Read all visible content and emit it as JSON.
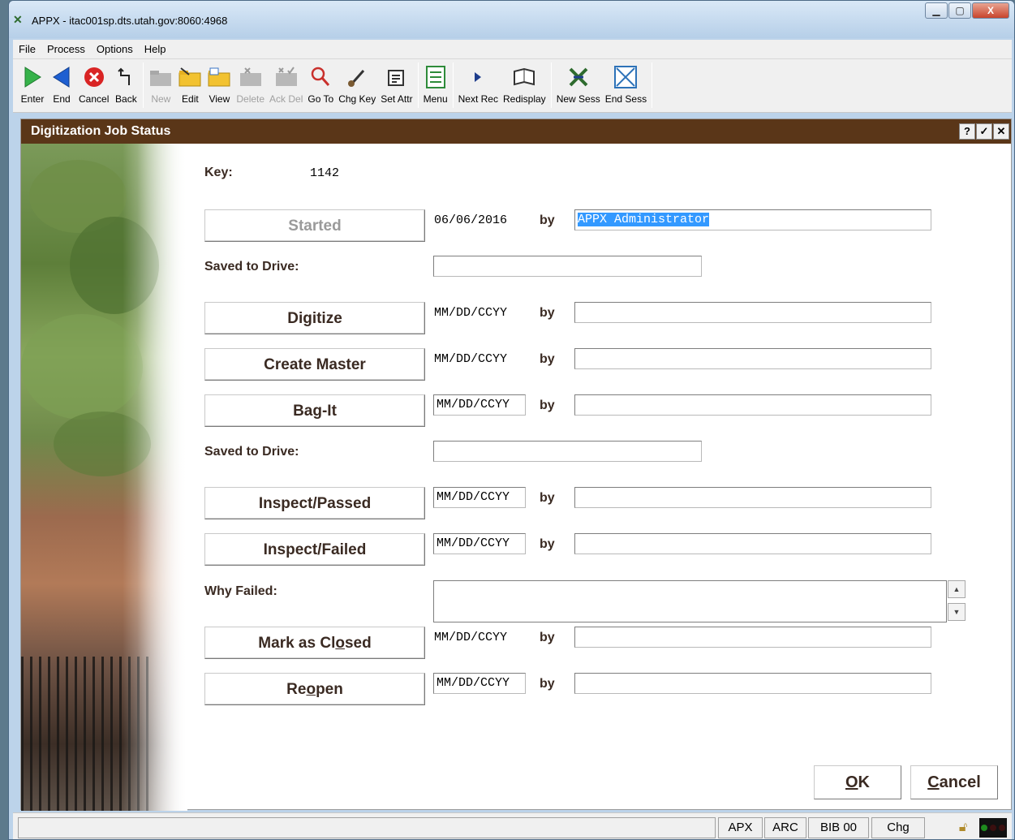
{
  "window": {
    "title": "APPX - itac001sp.dts.utah.gov:8060:4968",
    "controls": {
      "minimize": "▁",
      "maximize": "▢",
      "close": "X"
    }
  },
  "menu": [
    "File",
    "Process",
    "Options",
    "Help"
  ],
  "toolbar": [
    {
      "label": "Enter",
      "icon": "play-icon",
      "enabled": true
    },
    {
      "label": "End",
      "icon": "arrow-left-icon",
      "enabled": true
    },
    {
      "label": "Cancel",
      "icon": "cancel-icon",
      "enabled": true
    },
    {
      "label": "Back",
      "icon": "back-icon",
      "enabled": true
    },
    {
      "label": "New",
      "icon": "folder-new-icon",
      "enabled": false
    },
    {
      "label": "Edit",
      "icon": "folder-edit-icon",
      "enabled": true
    },
    {
      "label": "View",
      "icon": "folder-view-icon",
      "enabled": true
    },
    {
      "label": "Delete",
      "icon": "folder-delete-icon",
      "enabled": false
    },
    {
      "label": "Ack Del",
      "icon": "folder-ackdel-icon",
      "enabled": false
    },
    {
      "label": "Go To",
      "icon": "magnifier-icon",
      "enabled": true
    },
    {
      "label": "Chg Key",
      "icon": "key-icon",
      "enabled": true
    },
    {
      "label": "Set Attr",
      "icon": "attributes-icon",
      "enabled": true
    },
    {
      "label": "Menu",
      "icon": "menu-icon",
      "enabled": true
    },
    {
      "label": "Next Rec",
      "icon": "next-icon",
      "enabled": true
    },
    {
      "label": "Redisplay",
      "icon": "redisplay-icon",
      "enabled": true
    },
    {
      "label": "New Sess",
      "icon": "new-session-icon",
      "enabled": true
    },
    {
      "label": "End Sess",
      "icon": "end-session-icon",
      "enabled": true
    }
  ],
  "form": {
    "title": "Digitization Job Status",
    "header_buttons": [
      "?",
      "✓",
      "✕"
    ],
    "key_label": "Key:",
    "key_value": "1142",
    "by_label": "by",
    "saved_to_drive_label": "Saved to Drive:",
    "why_failed_label": "Why Failed:",
    "steps": {
      "started": {
        "button": "Started",
        "date": "06/06/2016",
        "by_value": "APPX Administrator"
      },
      "digitize": {
        "button": "Digitize",
        "date": "MM/DD/CCYY",
        "by_value": ""
      },
      "create_master": {
        "button": "Create Master",
        "date": "MM/DD/CCYY",
        "by_value": ""
      },
      "bag_it": {
        "button": "Bag-It",
        "date": "MM/DD/CCYY",
        "by_value": ""
      },
      "inspect_passed": {
        "button": "Inspect/Passed",
        "date": "MM/DD/CCYY",
        "by_value": ""
      },
      "inspect_failed": {
        "button": "Inspect/Failed",
        "date": "MM/DD/CCYY",
        "by_value": ""
      },
      "mark_closed": {
        "button_pre": "Mark as Cl",
        "button_u": "o",
        "button_post": "sed",
        "date": "MM/DD/CCYY",
        "by_value": ""
      },
      "reopen": {
        "button_pre": "Re",
        "button_u": "o",
        "button_post": "pen",
        "date": "MM/DD/CCYY",
        "by_value": ""
      }
    },
    "ok_u": "O",
    "ok_rest": "K",
    "cancel_u": "C",
    "cancel_rest": "ancel"
  },
  "status": {
    "panes": [
      "APX",
      "ARC",
      "BIB 00",
      "Chg"
    ]
  }
}
